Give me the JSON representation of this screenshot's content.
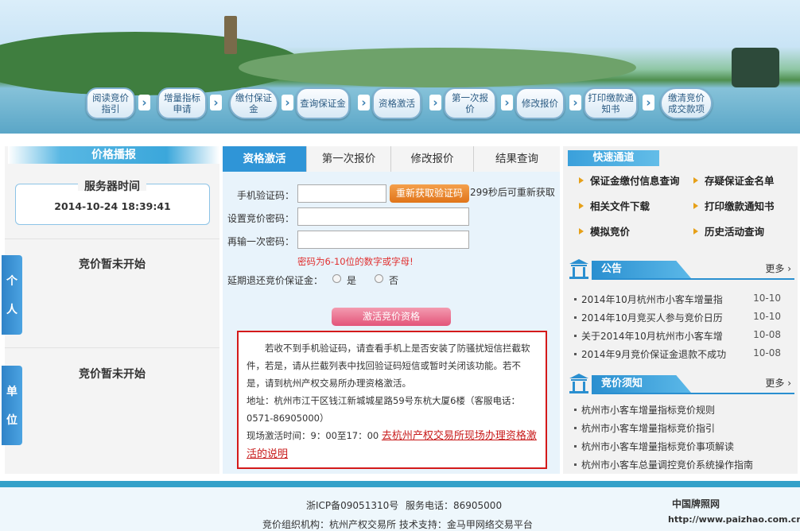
{
  "banner": {
    "steps": [
      {
        "label": "阅读竞价指引"
      },
      {
        "label": "增量指标申请"
      },
      {
        "label": "缴付保证金"
      },
      {
        "label": "查询保证金"
      },
      {
        "label": "资格激活"
      },
      {
        "label": "第一次报价"
      },
      {
        "label": "修改报价"
      },
      {
        "label": "打印缴款通知书"
      },
      {
        "label": "缴清竞价成交款项"
      }
    ],
    "arrow": "›"
  },
  "left": {
    "title": "价格播报",
    "server_title": "服务器时间",
    "server_time": "2014-10-24  18:39:41",
    "personal_tab": "个人",
    "personal_status": "竞价暂未开始",
    "company_tab": "单位",
    "company_status": "竞价暂未开始"
  },
  "tabs": [
    {
      "label": "资格激活",
      "active": true
    },
    {
      "label": "第一次报价",
      "active": false
    },
    {
      "label": "修改报价",
      "active": false
    },
    {
      "label": "结果查询",
      "active": false
    }
  ],
  "form": {
    "phone_code_label": "手机验证码：",
    "phone_code_value": "",
    "get_code_button": "重新获取验证码",
    "retry_text": "299秒后可重新获取",
    "set_password_label": "设置竞价密码：",
    "set_password_value": "",
    "confirm_password_label": "再输一次密码：",
    "confirm_password_value": "",
    "password_hint": "密码为6-10位的数字或字母!",
    "deposit_label": "延期退还竞价保证金：",
    "option_yes": "是",
    "option_no": "否",
    "activate_button": "激活竞价资格"
  },
  "notice": {
    "paragraph1": "若收不到手机验证码，请查看手机上是否安装了防骚扰短信拦截软件，若是，请从拦截列表中找回验证码短信或暂时关闭该功能。若不是，请到杭州产权交易所办理资格激活。",
    "address": "地址：杭州市江干区钱江新城城星路59号东杭大厦6楼（客服电话：0571-86905000）",
    "time_prefix": "现场激活时间：9：00至17：00",
    "link": "去杭州产权交易所现场办理资格激活的说明"
  },
  "quick": {
    "title": "快速通道",
    "items": [
      {
        "label": "保证金缴付信息查询"
      },
      {
        "label": "存疑保证金名单"
      },
      {
        "label": "相关文件下载"
      },
      {
        "label": "打印缴款通知书"
      },
      {
        "label": "模拟竞价"
      },
      {
        "label": "历史活动查询"
      }
    ]
  },
  "announcements": {
    "title": "公告",
    "more": "更多",
    "items": [
      {
        "title": "2014年10月杭州市小客车增量指",
        "date": "10-10"
      },
      {
        "title": "2014年10月竞买人参与竞价日历",
        "date": "10-10"
      },
      {
        "title": "关于2014年10月杭州市小客车增",
        "date": "10-08"
      },
      {
        "title": "2014年9月竞价保证金退款不成功",
        "date": "10-08"
      }
    ]
  },
  "rules": {
    "title": "竞价须知",
    "more": "更多",
    "items": [
      {
        "title": "杭州市小客车增量指标竞价规则"
      },
      {
        "title": "杭州市小客车增量指标竞价指引"
      },
      {
        "title": "杭州市小客车增量指标竞价事项解读"
      },
      {
        "title": "杭州市小客车总量调控竞价系统操作指南"
      }
    ]
  },
  "footer": {
    "icp": "浙ICP备09051310号",
    "phone": "服务电话：86905000",
    "org": "竞价组织机构：杭州产权交易所  技术支持：金马甲网络交易平台",
    "watermark_title": "中国牌照网",
    "watermark_url": "http://www.paizhao.com.cn"
  },
  "colors": {
    "accent_blue": "#2f95d7",
    "orange_button": "#e07419",
    "pink_button": "#e35479",
    "notice_border": "#d41a1a"
  }
}
